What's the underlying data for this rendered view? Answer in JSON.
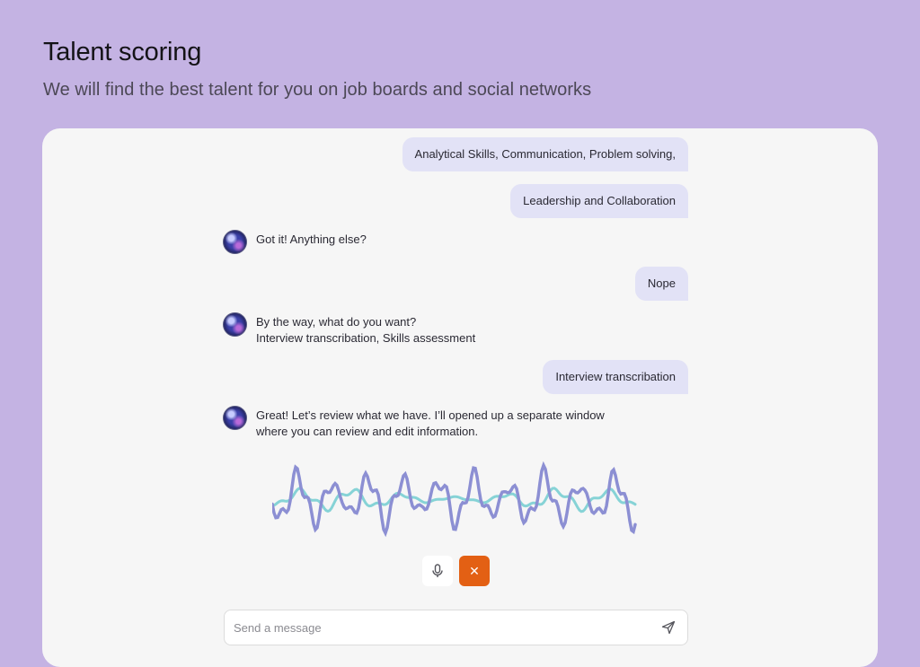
{
  "header": {
    "title": "Talent scoring",
    "subtitle": "We will find the best talent for you on job boards and social networks"
  },
  "chat": {
    "messages": [
      {
        "role": "user",
        "text": "Analytical Skills, Communication, Problem solving,"
      },
      {
        "role": "user",
        "text": "Leadership and Collaboration"
      },
      {
        "role": "bot",
        "lines": [
          "Got it! Anything else?"
        ]
      },
      {
        "role": "user",
        "text": "Nope"
      },
      {
        "role": "bot",
        "lines": [
          "By the way, what do you want?",
          "Interview transcribation, Skills assessment"
        ]
      },
      {
        "role": "user",
        "text": "Interview transcribation"
      },
      {
        "role": "bot",
        "lines": [
          "Great! Let’s review what we have. I’ll opened up a separate window",
          "where you can review and edit information."
        ]
      }
    ]
  },
  "voice": {
    "mic_icon": "microphone-icon",
    "close_icon": "close-icon",
    "close_glyph": "✕",
    "wave_colors": [
      "#8c8fd3",
      "#86d3d6"
    ],
    "accent": "#e36014"
  },
  "composer": {
    "placeholder": "Send a message",
    "send_icon": "send-icon"
  }
}
